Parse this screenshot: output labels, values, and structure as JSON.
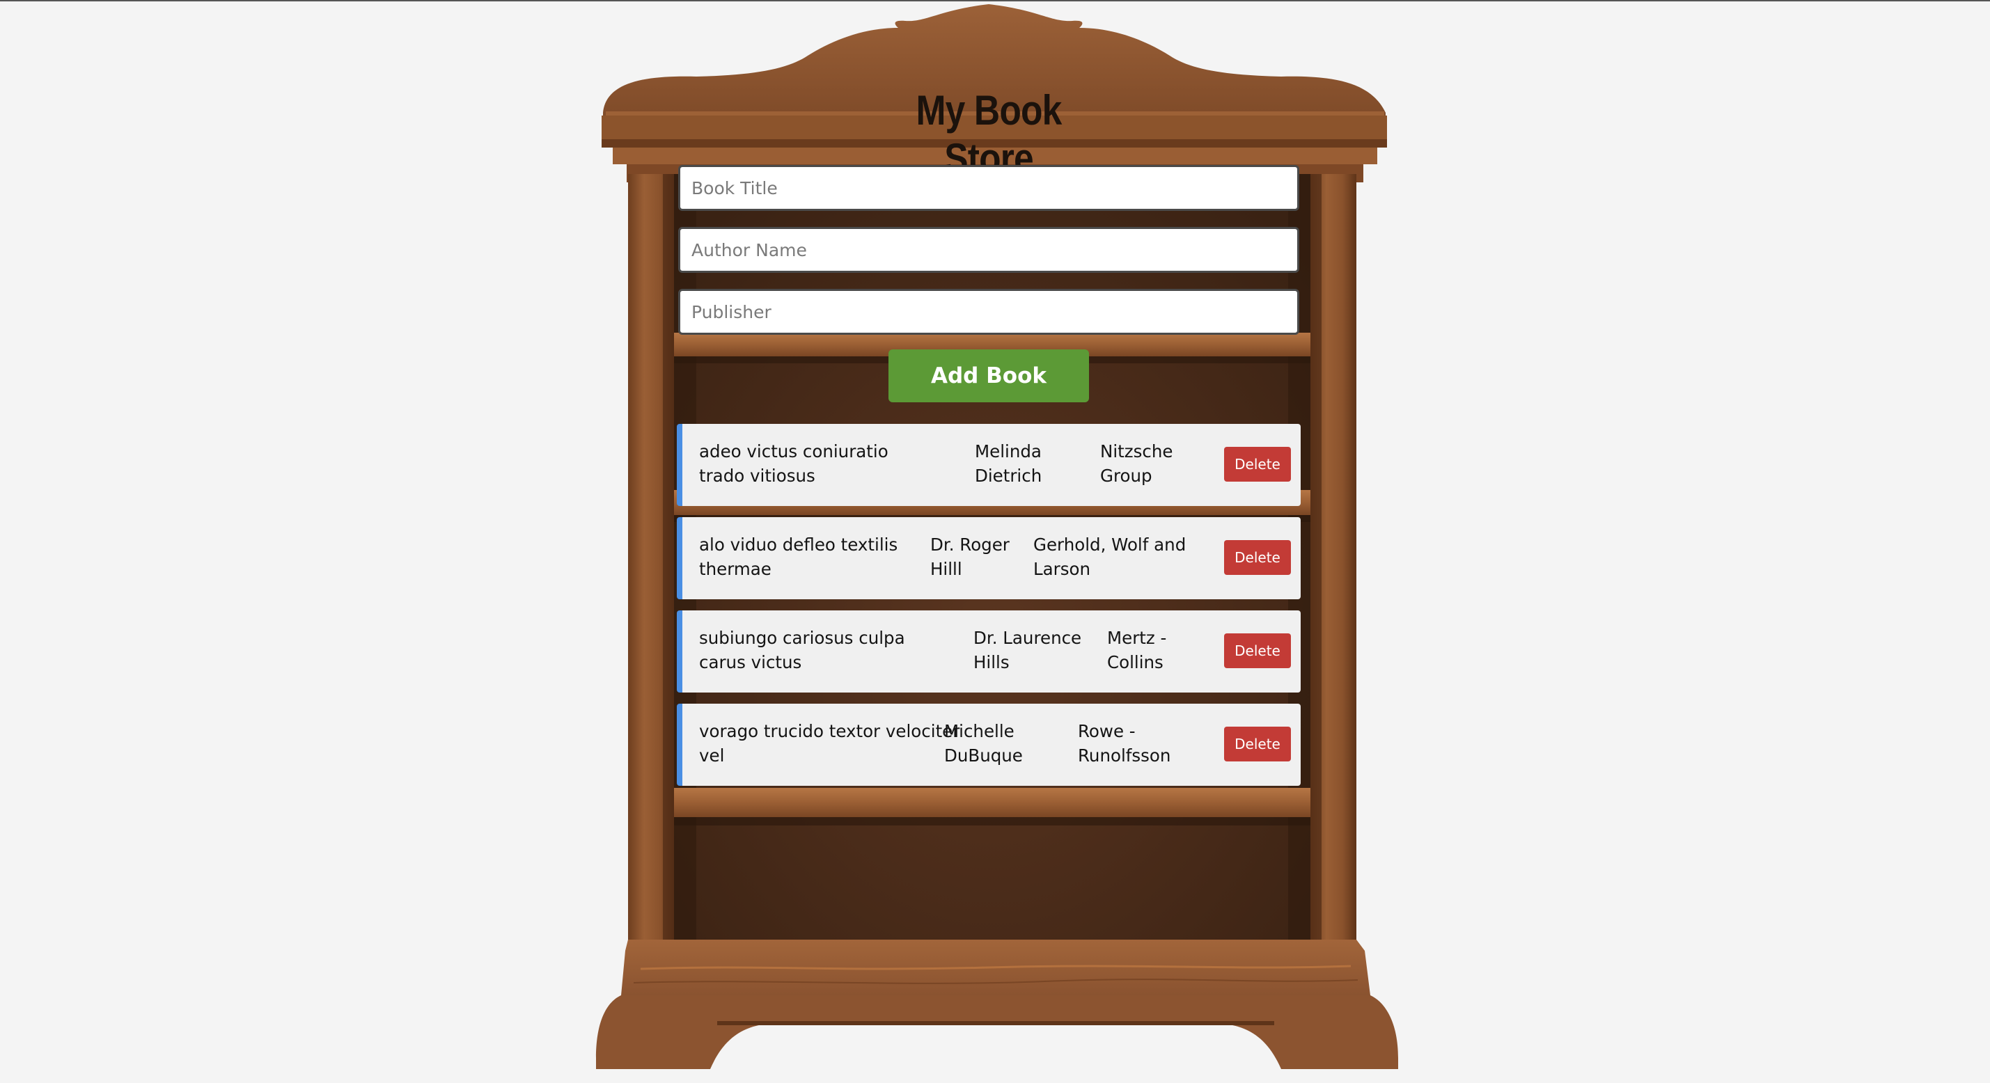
{
  "app": {
    "title": "My Book Store"
  },
  "form": {
    "title_placeholder": "Book Title",
    "author_placeholder": "Author Name",
    "publisher_placeholder": "Publisher",
    "title_value": "",
    "author_value": "",
    "publisher_value": "",
    "add_label": "Add Book"
  },
  "books": [
    {
      "title": "adeo victus coniuratio trado vitiosus",
      "author": "Melinda Dietrich",
      "publisher": "Nitzsche Group",
      "delete_label": "Delete"
    },
    {
      "title": "alo viduo defleo textilis thermae",
      "author": "Dr. Roger Hilll",
      "publisher": "Gerhold, Wolf and Larson",
      "delete_label": "Delete"
    },
    {
      "title": "subiungo cariosus culpa carus victus",
      "author": "Dr. Laurence Hills",
      "publisher": "Mertz - Collins",
      "delete_label": "Delete"
    },
    {
      "title": "vorago trucido textor velociter vel",
      "author": "Michelle DuBuque",
      "publisher": "Rowe - Runolfsson",
      "delete_label": "Delete"
    }
  ],
  "colors": {
    "accent_add": "#5c9a36",
    "accent_delete": "#c33b36",
    "book_border": "#4a8fe4",
    "wood": "#8a5630",
    "wood_dark": "#3f2618"
  }
}
